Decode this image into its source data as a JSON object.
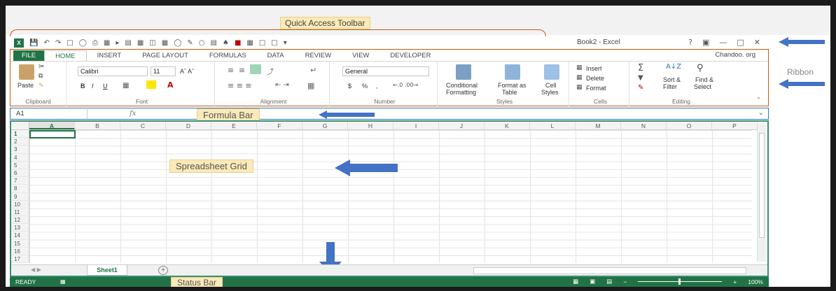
{
  "annotations": {
    "quick_access_toolbar": "Quick Access Toolbar",
    "ribbon": "Ribbon",
    "formula_bar": "Formula Bar",
    "spreadsheet_grid": "Spreadsheet Grid",
    "status_bar": "Status Bar"
  },
  "window": {
    "title": "Book2 - Excel",
    "help": "?",
    "account": "Chandoo. org"
  },
  "tabs": [
    "FILE",
    "HOME",
    "INSERT",
    "PAGE LAYOUT",
    "FORMULAS",
    "DATA",
    "REVIEW",
    "VIEW",
    "DEVELOPER"
  ],
  "ribbon": {
    "clipboard": {
      "paste": "Paste",
      "label": "Clipboard"
    },
    "font": {
      "name": "Calibri",
      "size": "11",
      "bold": "B",
      "italic": "I",
      "underline": "U",
      "label": "Font"
    },
    "alignment": {
      "label": "Alignment"
    },
    "number": {
      "format": "General",
      "currency": "$",
      "percent": "%",
      "comma": ",",
      "label": "Number"
    },
    "styles": {
      "conditional_1": "Conditional",
      "conditional_2": "Formatting",
      "format_table_1": "Format as",
      "format_table_2": "Table",
      "cell_styles_1": "Cell",
      "cell_styles_2": "Styles",
      "label": "Styles"
    },
    "cells": {
      "insert": "Insert",
      "delete": "Delete",
      "format": "Format",
      "label": "Cells"
    },
    "editing": {
      "sort_1": "Sort &",
      "sort_2": "Filter",
      "find_1": "Find &",
      "find_2": "Select",
      "label": "Editing"
    }
  },
  "formula_bar": {
    "name_box": "A1",
    "fx": "fx"
  },
  "grid": {
    "columns": [
      "A",
      "B",
      "C",
      "D",
      "E",
      "F",
      "G",
      "H",
      "I",
      "J",
      "K",
      "L",
      "M",
      "N",
      "O",
      "P"
    ],
    "rows": [
      "1",
      "2",
      "3",
      "4",
      "5",
      "6",
      "7",
      "8",
      "9",
      "10",
      "11",
      "12",
      "13",
      "14",
      "15",
      "16",
      "17"
    ],
    "selected_cell": "A1"
  },
  "sheets": [
    "Sheet1"
  ],
  "status": {
    "ready": "READY",
    "zoom": "100%"
  },
  "colors": {
    "excel_green": "#217346",
    "annotation_orange": "#c55a11",
    "arrow_blue": "#4472c4"
  }
}
